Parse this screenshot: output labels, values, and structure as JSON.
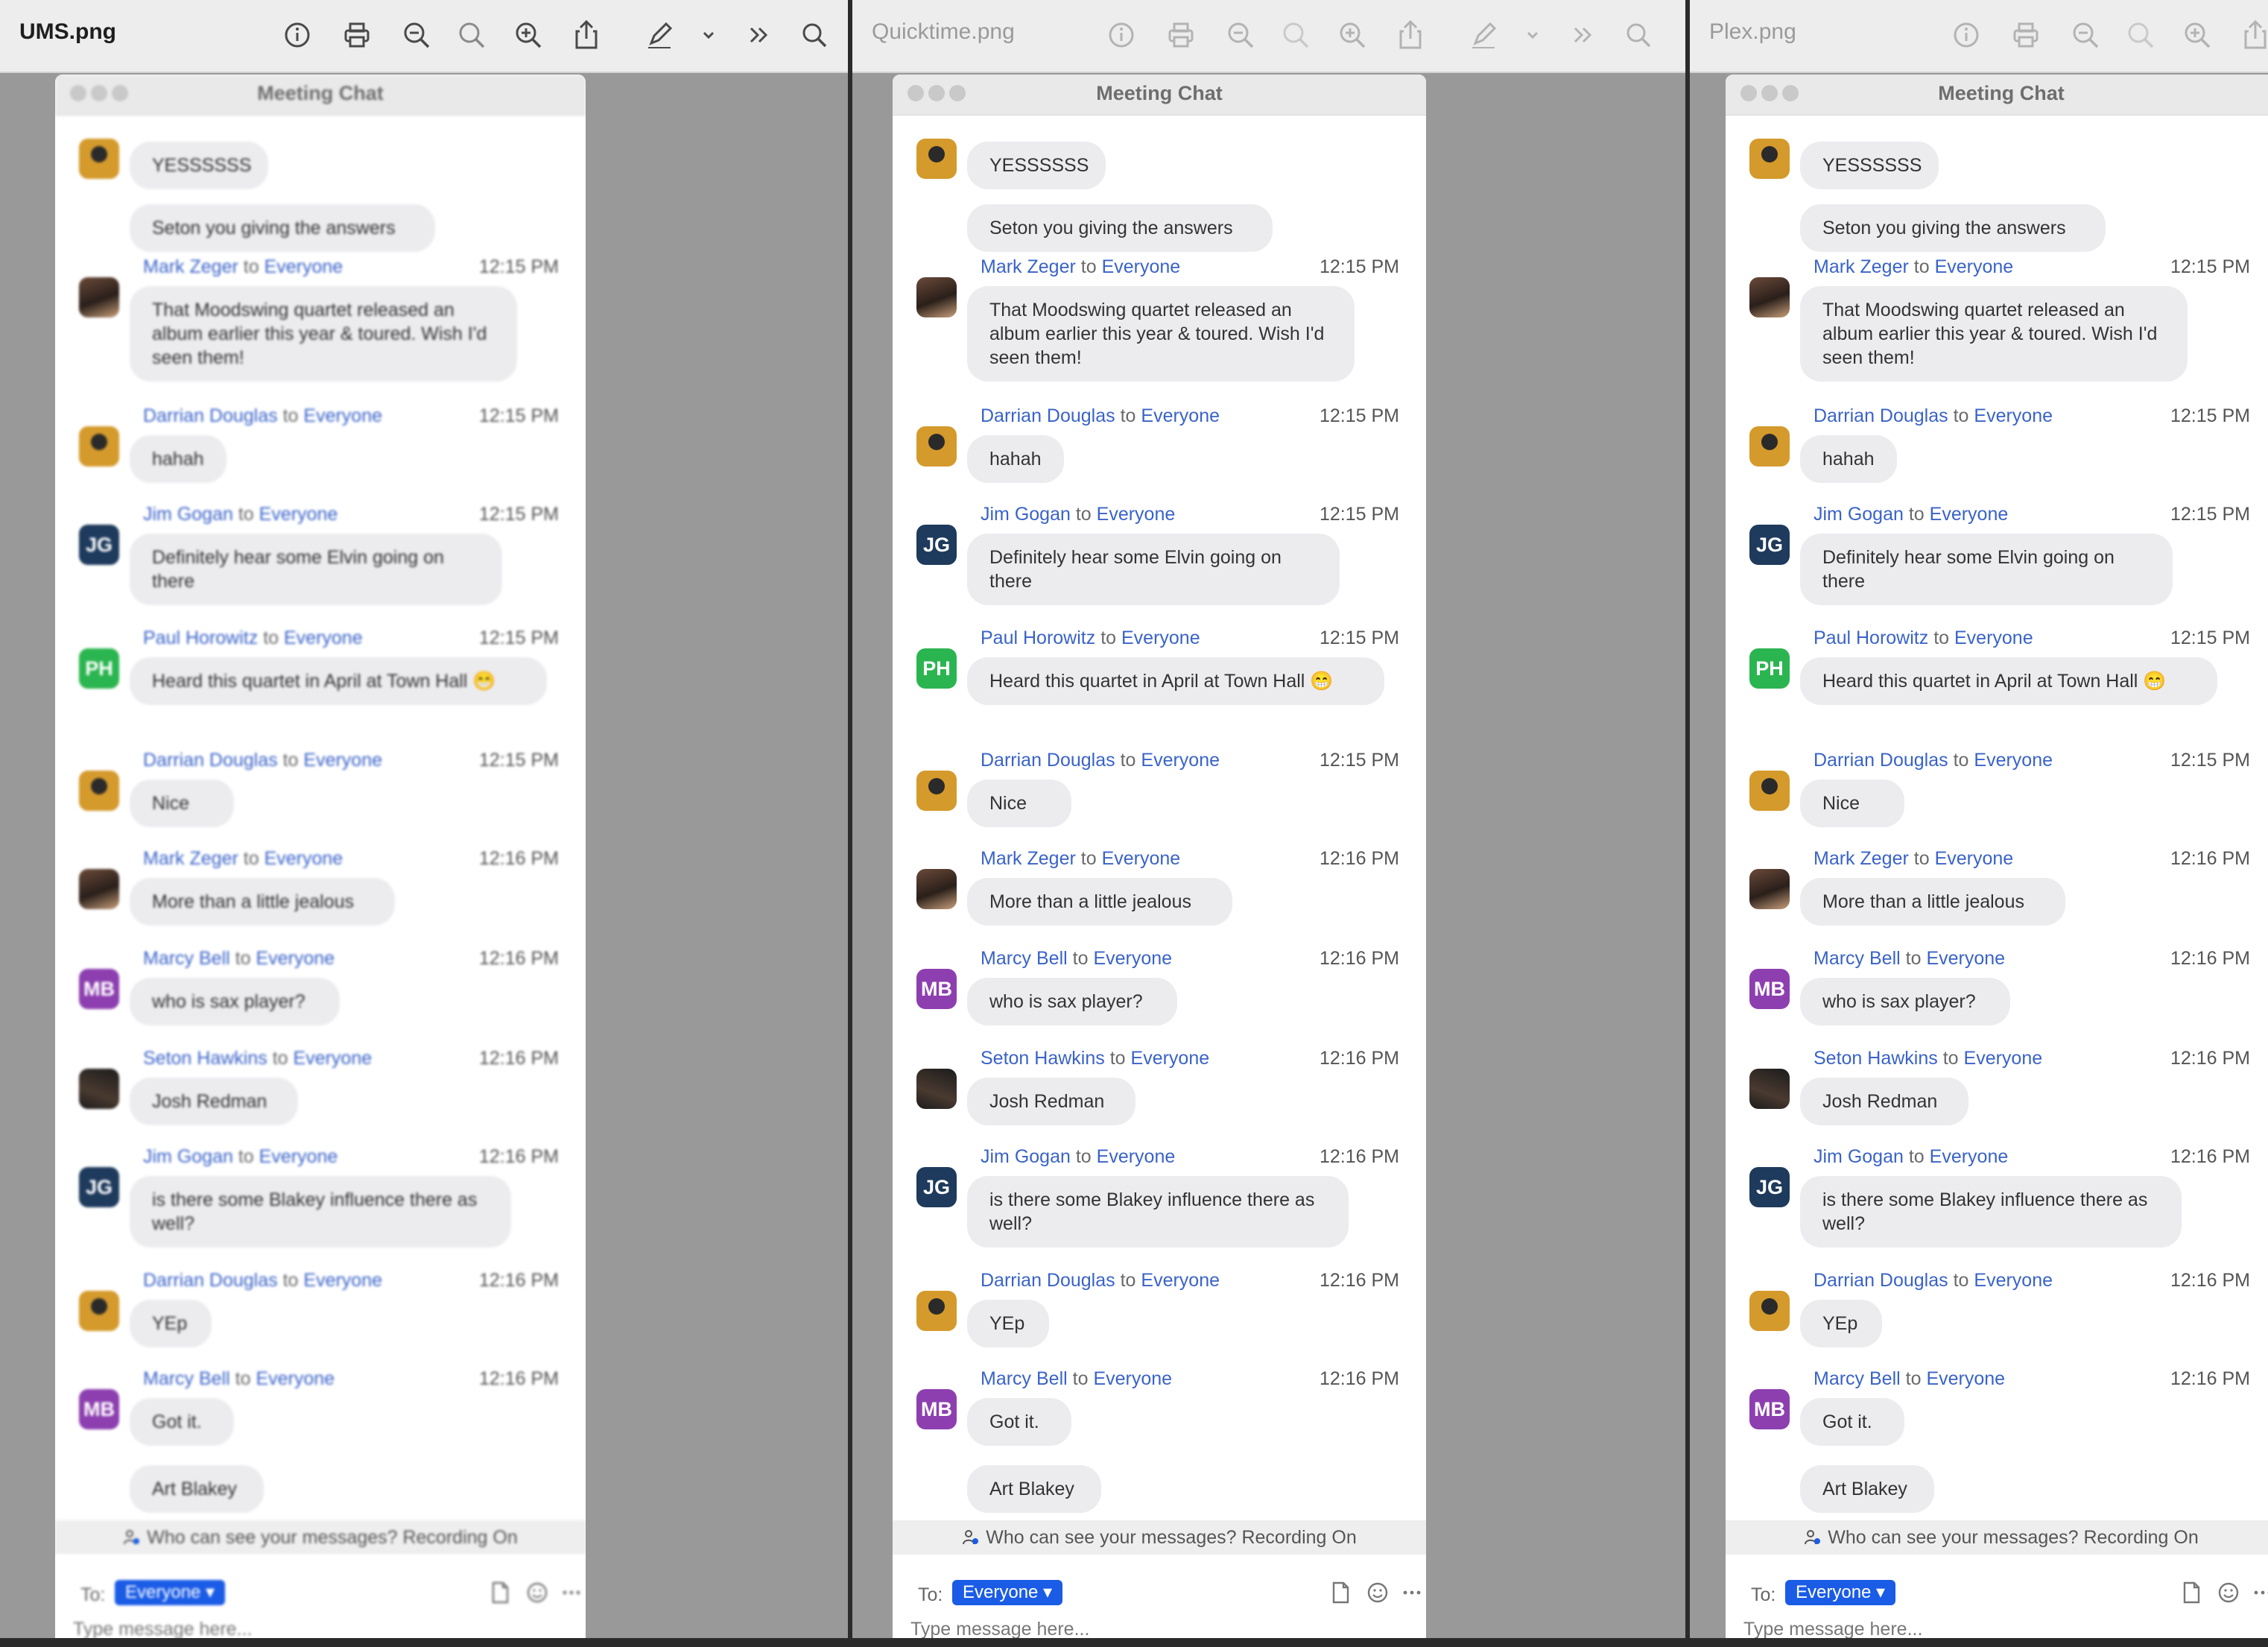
{
  "windows": [
    {
      "file_name": "UMS.png"
    },
    {
      "file_name": "Quicktime.png"
    },
    {
      "file_name": "Plex.png"
    }
  ],
  "chat": {
    "title": "Meeting Chat",
    "to_word": "to",
    "messages": [
      {
        "sender": "",
        "recipient": "",
        "time": "",
        "text": "YESSSSSS",
        "avatar": "logo"
      },
      {
        "sender": "",
        "recipient": "",
        "time": "",
        "text": "Seton you giving the answers",
        "avatar": ""
      },
      {
        "sender": "Mark Zeger",
        "recipient": "Everyone",
        "time": "12:15 PM",
        "text": "That Moodswing quartet released an album earlier this year & toured. Wish I'd seen them!",
        "avatar": "photo"
      },
      {
        "sender": "Darrian Douglas",
        "recipient": "Everyone",
        "time": "12:15 PM",
        "text": "hahah",
        "avatar": "logo"
      },
      {
        "sender": "Jim Gogan",
        "recipient": "Everyone",
        "time": "12:15 PM",
        "text": "Definitely hear some Elvin going on there",
        "avatar": "JG"
      },
      {
        "sender": "Paul Horowitz",
        "recipient": "Everyone",
        "time": "12:15 PM",
        "text": "Heard this quartet in April at Town Hall 😁",
        "avatar": "PH"
      },
      {
        "sender": "Darrian Douglas",
        "recipient": "Everyone",
        "time": "12:15 PM",
        "text": "Nice",
        "avatar": "logo"
      },
      {
        "sender": "Mark Zeger",
        "recipient": "Everyone",
        "time": "12:16 PM",
        "text": "More than a little jealous",
        "avatar": "photo"
      },
      {
        "sender": "Marcy Bell",
        "recipient": "Everyone",
        "time": "12:16 PM",
        "text": "who is sax player?",
        "avatar": "MB"
      },
      {
        "sender": "Seton Hawkins",
        "recipient": "Everyone",
        "time": "12:16 PM",
        "text": "Josh Redman",
        "avatar": "photo2"
      },
      {
        "sender": "Jim Gogan",
        "recipient": "Everyone",
        "time": "12:16 PM",
        "text": "is there some Blakey influence there as well?",
        "avatar": "JG"
      },
      {
        "sender": "Darrian Douglas",
        "recipient": "Everyone",
        "time": "12:16 PM",
        "text": "YEp",
        "avatar": "logo"
      },
      {
        "sender": "Marcy Bell",
        "recipient": "Everyone",
        "time": "12:16 PM",
        "text": "Got it.",
        "avatar": "MB"
      },
      {
        "sender": "",
        "recipient": "",
        "time": "",
        "text": "Art Blakey",
        "avatar": ""
      }
    ],
    "notice": "Who can see your messages? Recording On",
    "to_label": "To:",
    "recipient_selector": "Everyone ▾",
    "input_placeholder": "Type message here..."
  }
}
